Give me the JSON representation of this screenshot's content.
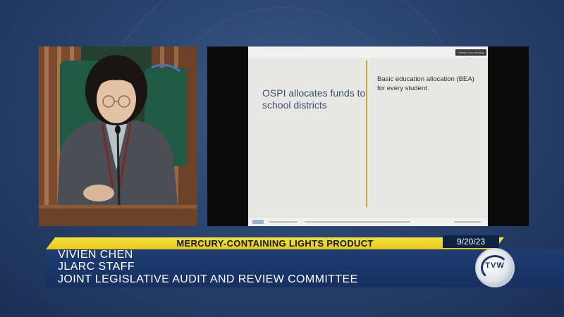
{
  "slide": {
    "toolbar_label": "Hiding Ursa Viewing Tools",
    "title": "OSPI allocates funds to school districts",
    "body": "Basic education allocation (BEA) for every student."
  },
  "lower_third": {
    "topic": "MERCURY-CONTAINING LIGHTS PRODUCT",
    "date": "9/20/23",
    "name": "VIVIEN CHEN",
    "role": "JLARC STAFF",
    "organization": "JOINT LEGISLATIVE AUDIT AND REVIEW COMMITTEE"
  },
  "logo": {
    "text": "TVW"
  },
  "colors": {
    "banner_yellow": "#f0d52c",
    "banner_blue": "#1c3868",
    "slide_accent": "#d4a72c",
    "slide_title": "#3c4f6e"
  }
}
